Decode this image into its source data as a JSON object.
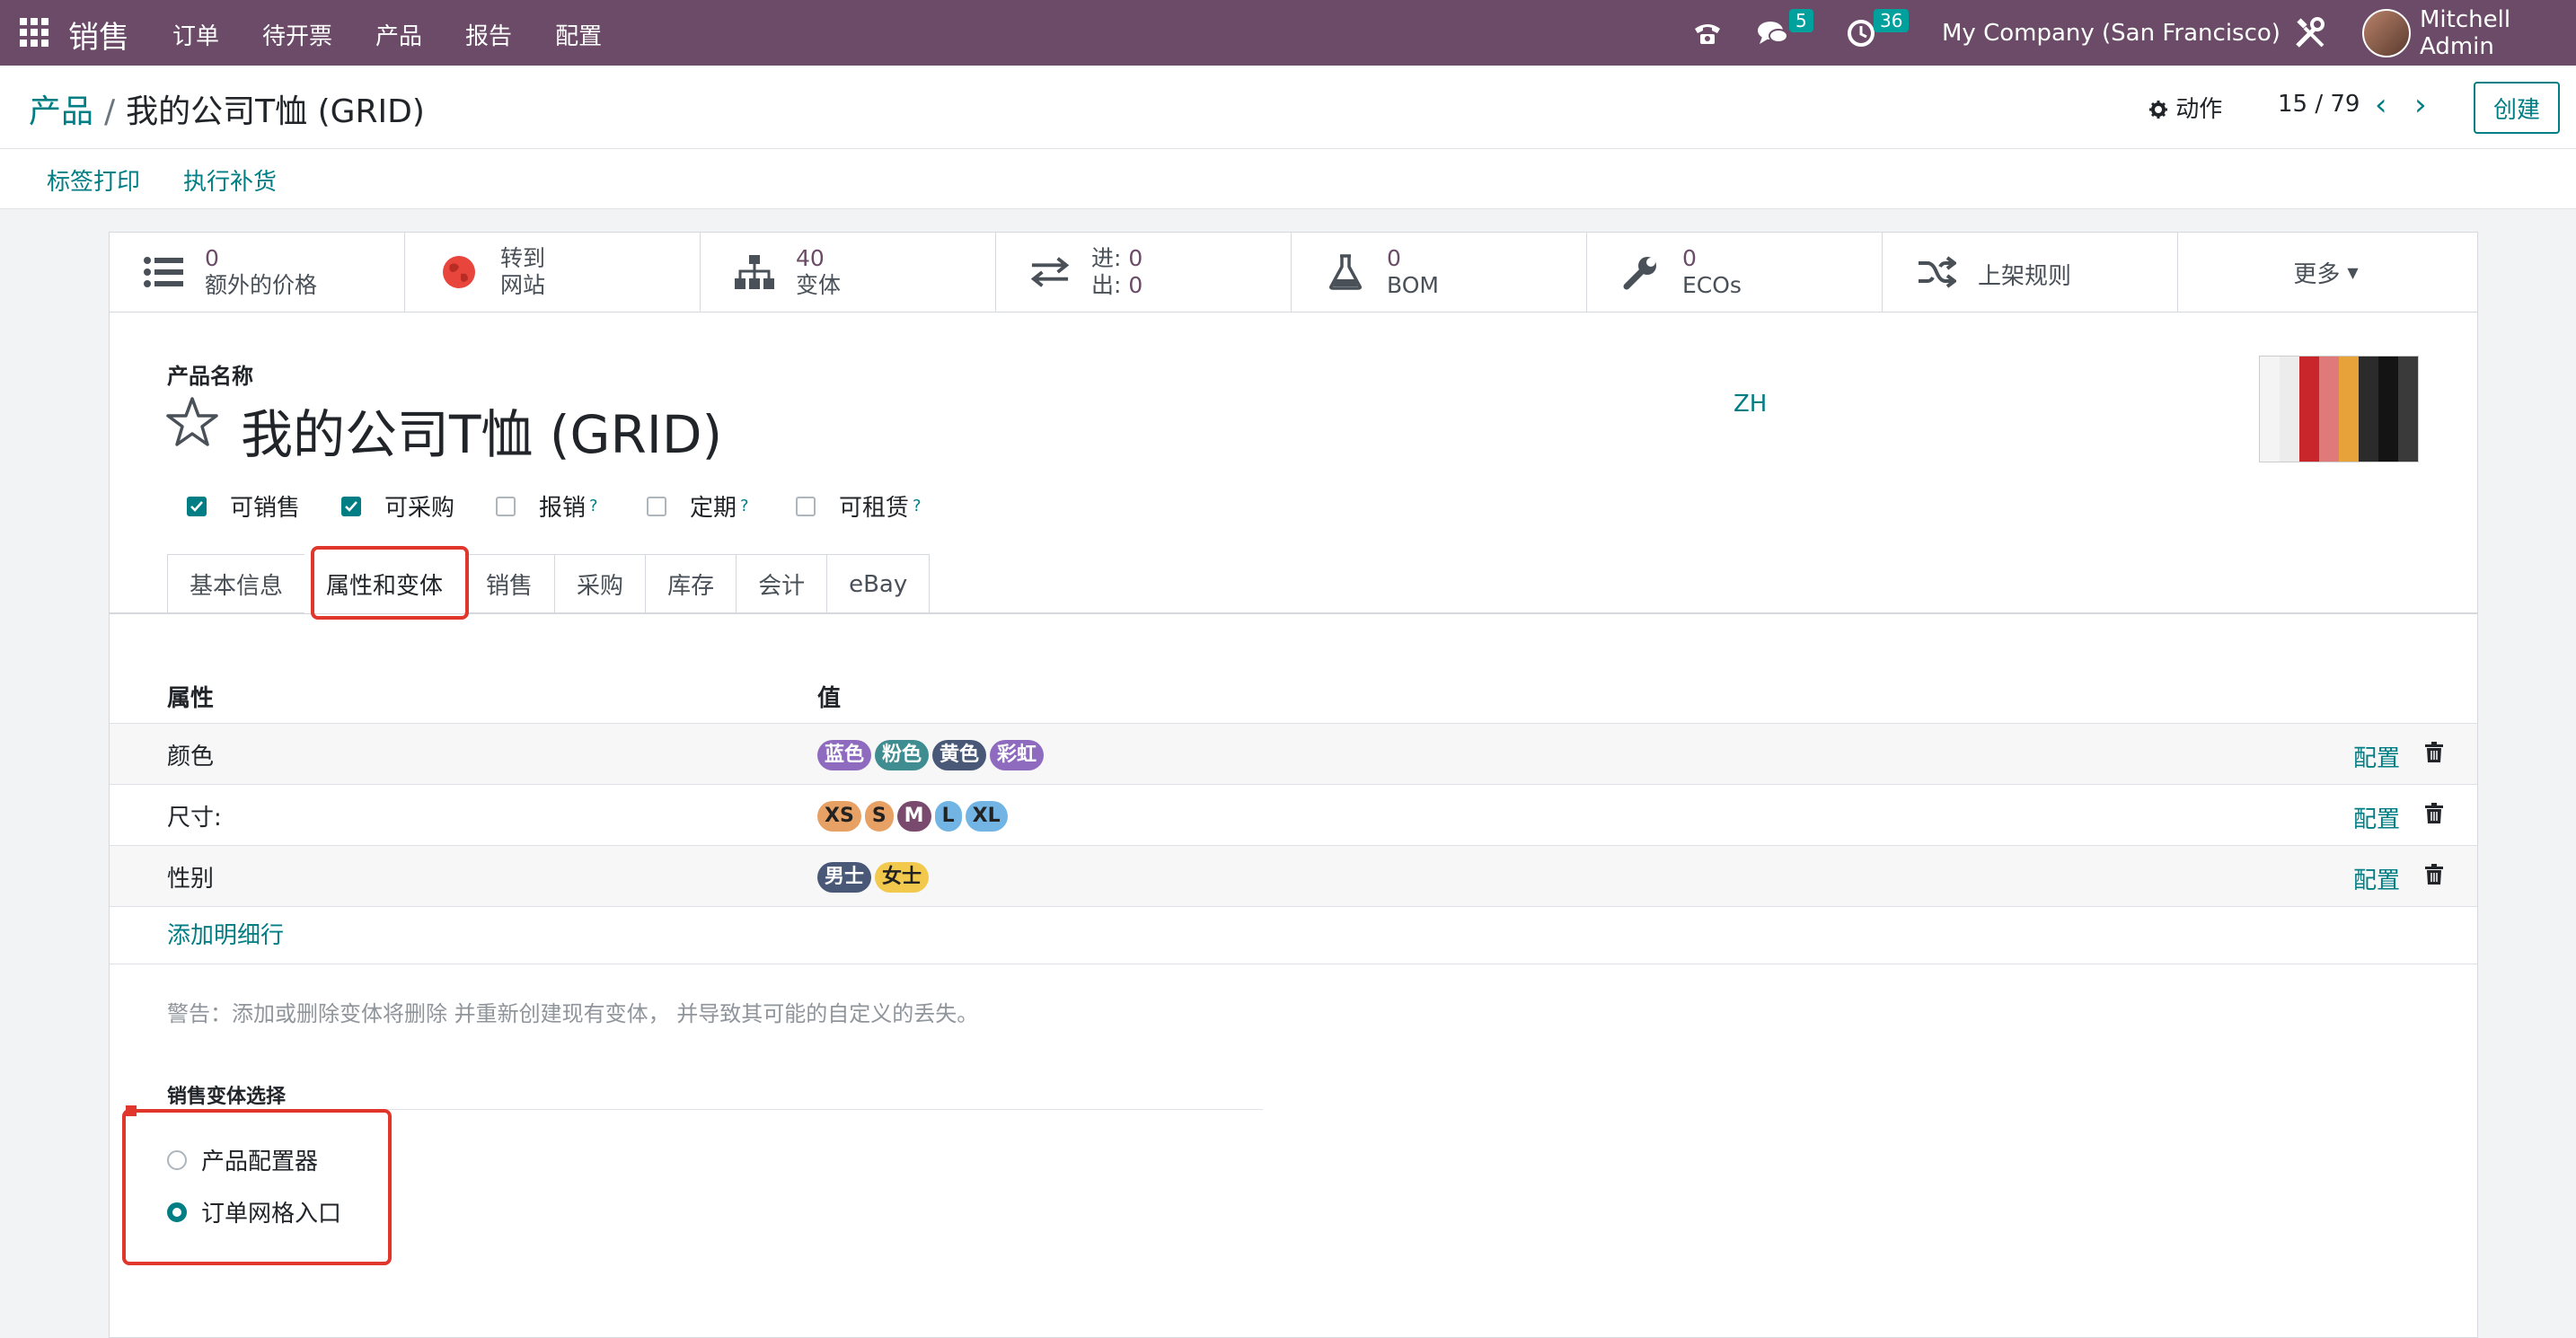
{
  "navbar": {
    "app_name": "销售",
    "menu": [
      "订单",
      "待开票",
      "产品",
      "报告",
      "配置"
    ],
    "messages_count": "5",
    "activities_count": "36",
    "company": "My Company (San Francisco)",
    "user": "Mitchell Admin"
  },
  "breadcrumb": {
    "parent": "产品",
    "separator": "/",
    "current": "我的公司T恤 (GRID)"
  },
  "control": {
    "actions_label": "动作",
    "pager": "15 / 79",
    "create_label": "创建"
  },
  "statusbar": {
    "buttons": [
      "标签打印",
      "执行补货"
    ]
  },
  "smart_buttons": {
    "extra_price": {
      "value": "0",
      "label": "额外的价格"
    },
    "website": {
      "line1": "转到",
      "line2": "网站"
    },
    "variants": {
      "value": "40",
      "label": "变体"
    },
    "in_out": {
      "in_label": "进:",
      "in_value": "0",
      "out_label": "出:",
      "out_value": "0"
    },
    "bom": {
      "value": "0",
      "label": "BOM"
    },
    "ecos": {
      "value": "0",
      "label": "ECOs"
    },
    "putaway": {
      "label": "上架规则"
    },
    "more": {
      "label": "更多"
    }
  },
  "product": {
    "name_label": "产品名称",
    "name": "我的公司T恤 (GRID)",
    "lang": "ZH",
    "options": [
      {
        "label": "可销售",
        "checked": true,
        "help": false
      },
      {
        "label": "可采购",
        "checked": true,
        "help": false
      },
      {
        "label": "报销",
        "checked": false,
        "help": true
      },
      {
        "label": "定期",
        "checked": false,
        "help": true
      },
      {
        "label": "可租赁",
        "checked": false,
        "help": true
      }
    ],
    "help_mark": "?"
  },
  "tabs": [
    "基本信息",
    "属性和变体",
    "销售",
    "采购",
    "库存",
    "会计",
    "eBay"
  ],
  "active_tab": "属性和变体",
  "attributes": {
    "headers": {
      "attribute": "属性",
      "values": "值"
    },
    "rows": [
      {
        "name": "颜色",
        "values": [
          {
            "label": "蓝色",
            "color": "#8e6bbf"
          },
          {
            "label": "粉色",
            "color": "#3f8c91"
          },
          {
            "label": "黄色",
            "color": "#4a5878"
          },
          {
            "label": "彩虹",
            "color": "#8e6bbf"
          }
        ]
      },
      {
        "name": "尺寸:",
        "values": [
          {
            "label": "XS",
            "color": "#e8a165"
          },
          {
            "label": "S",
            "color": "#e8a165"
          },
          {
            "label": "M",
            "color": "#7a4a6e"
          },
          {
            "label": "L",
            "color": "#72b5e4"
          },
          {
            "label": "XL",
            "color": "#72b5e4"
          }
        ]
      },
      {
        "name": "性别",
        "values": [
          {
            "label": "男士",
            "color": "#4a5878"
          },
          {
            "label": "女士",
            "color": "#f2c94c"
          }
        ]
      }
    ],
    "configure_label": "配置",
    "add_line_label": "添加明细行"
  },
  "warning": "警告：添加或删除变体将删除 并重新创建现有变体， 并导致其可能的自定义的丢失。",
  "sales_variant": {
    "label": "销售变体选择",
    "options": [
      {
        "label": "产品配置器",
        "selected": false
      },
      {
        "label": "订单网格入口",
        "selected": true
      }
    ]
  }
}
